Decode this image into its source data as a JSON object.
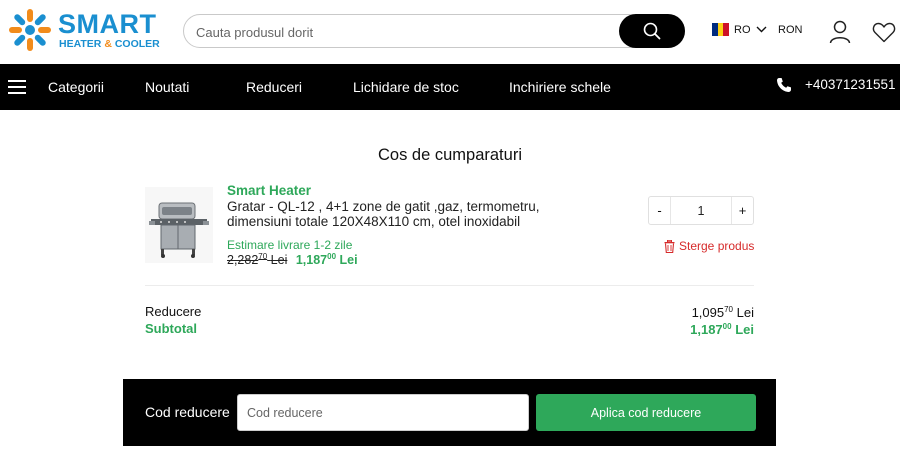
{
  "header": {
    "logo": {
      "word": "SMART",
      "tag_heater": "HEATER",
      "tag_amp": "&",
      "tag_cooler": "COOLER"
    },
    "search": {
      "placeholder": "Cauta produsul dorit",
      "icon": "search-icon"
    },
    "language": {
      "code": "RO",
      "flag_colors": [
        "#002b7f",
        "#fcd116",
        "#ce1126"
      ]
    },
    "currency": "RON",
    "icons": [
      "user-icon",
      "heart-icon"
    ]
  },
  "nav": {
    "items": [
      {
        "label": "Categorii"
      },
      {
        "label": "Noutati"
      },
      {
        "label": "Reduceri"
      },
      {
        "label": "Lichidare de stoc"
      },
      {
        "label": "Inchiriere schele"
      }
    ],
    "phone": "+40371231551"
  },
  "cart": {
    "title": "Cos de cumparaturi",
    "item": {
      "brand": "Smart Heater",
      "name": "Gratar - QL-12 , 4+1 zone de gatit ,gaz, termometru, dimensiuni totale 120X48X110 cm, otel inoxidabil",
      "delivery": "Estimare livrare 1-2 zile",
      "old_price_int": "2,282",
      "old_price_dec": "70",
      "old_price_cur": "Lei",
      "new_price_int": "1,187",
      "new_price_dec": "00",
      "new_price_cur": "Lei",
      "qty_minus": "-",
      "quantity": "1",
      "qty_plus": "+",
      "remove_label": "Sterge produs"
    },
    "summary": {
      "reducere_label": "Reducere",
      "reducere_int": "1,095",
      "reducere_dec": "70",
      "reducere_cur": "Lei",
      "subtotal_label": "Subtotal",
      "subtotal_int": "1,187",
      "subtotal_dec": "00",
      "subtotal_cur": "Lei"
    },
    "coupon": {
      "label": "Cod reducere",
      "placeholder": "Cod reducere",
      "button": "Aplica cod reducere"
    }
  },
  "colors": {
    "accent_green": "#2ea85a",
    "brand_blue": "#1a8fd0",
    "brand_orange": "#f28c1c",
    "danger_red": "#d62a2a",
    "nav_bg": "#000000"
  }
}
